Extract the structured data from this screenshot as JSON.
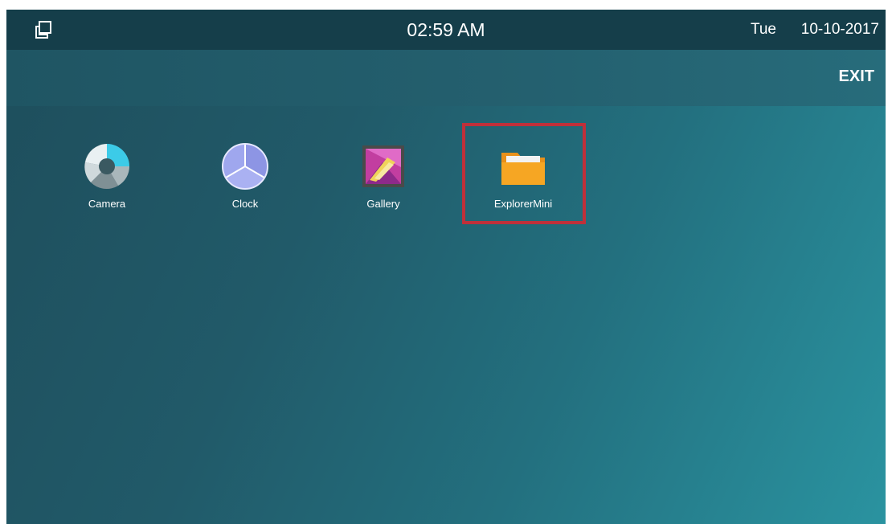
{
  "status_bar": {
    "time": "02:59 AM",
    "day": "Tue",
    "date": "10-10-2017",
    "windows_icon": "multi-window-icon"
  },
  "action_bar": {
    "exit_label": "EXIT"
  },
  "apps": [
    {
      "label": "Camera",
      "icon": "camera-icon"
    },
    {
      "label": "Clock",
      "icon": "clock-icon"
    },
    {
      "label": "Gallery",
      "icon": "gallery-icon"
    },
    {
      "label": "ExplorerMini",
      "icon": "folder-icon"
    }
  ],
  "highlight": {
    "target": "ExplorerMini",
    "color": "#c0303a"
  },
  "colors": {
    "status_bar": "#153e4a",
    "background_start": "#1e4e5c",
    "background_end": "#2a93a0"
  }
}
